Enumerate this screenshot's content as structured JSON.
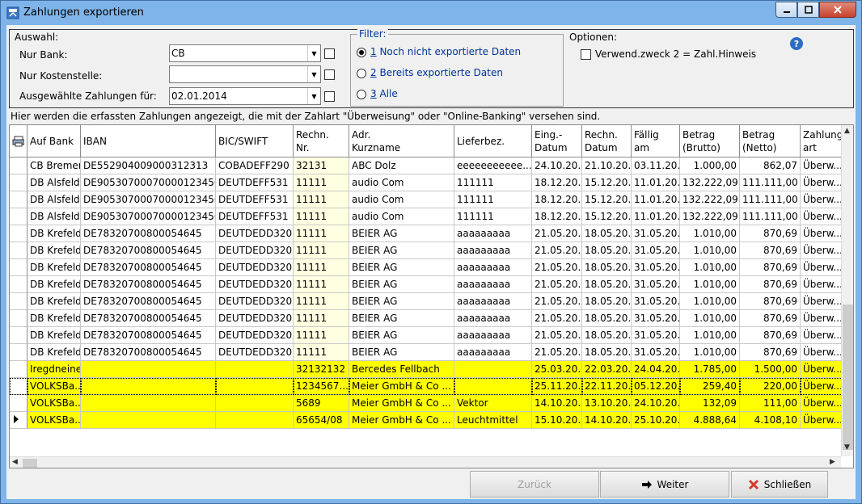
{
  "window": {
    "title": "Zahlungen exportieren"
  },
  "selection": {
    "legend": "Auswahl:",
    "bank_label": "Nur Bank:",
    "bank_value": "CB",
    "cost_label": "Nur Kostenstelle:",
    "cost_value": "",
    "date_label": "Ausgewählte Zahlungen für:",
    "date_value": "02.01.2014"
  },
  "filter": {
    "legend": "Filter:",
    "options": [
      {
        "label": "1 Noch nicht exportierte Daten",
        "selected": true
      },
      {
        "label": "2 Bereits exportierte Daten",
        "selected": false
      },
      {
        "label": "3 Alle",
        "selected": false
      }
    ]
  },
  "options": {
    "legend": "Optionen:",
    "verwendungszweck_label": "Verwend.zweck 2 = Zahl.Hinweis"
  },
  "info_text": "Hier werden die erfassten Zahlungen angezeigt, die mit der Zahlart \"Überweisung\" oder \"Online-Banking\" versehen sind.",
  "grid": {
    "headers": [
      "Auf Bank",
      "IBAN",
      "BIC/SWIFT",
      "Rechn.\nNr.",
      "Adr.\nKurzname",
      "Lieferbez.",
      "Eing.-\nDatum",
      "Rechn.\nDatum",
      "Fällig\nam",
      "Betrag\n(Brutto)",
      "Betrag\n(Netto)",
      "Zahlungs\nart"
    ],
    "rows": [
      {
        "style": "white",
        "cells": [
          "CB Bremen",
          "DE552904009000312313",
          "COBADEFF290",
          "32131",
          "ABC Dolz",
          "eeeeeeeeeee...",
          "24.10.20...",
          "21.10.20...",
          "03.11.20...",
          "1.000,00",
          "862,07",
          "Überw..."
        ]
      },
      {
        "style": "white",
        "cells": [
          "DB Alsfeld",
          "DE90530700070000123456",
          "DEUTDEFF531",
          "11111",
          "audio Com",
          "111111",
          "18.12.20...",
          "15.12.20...",
          "11.01.20...",
          "132.222,09",
          "111.111,00",
          "Überw..."
        ]
      },
      {
        "style": "white",
        "cells": [
          "DB Alsfeld",
          "DE90530700070000123456",
          "DEUTDEFF531",
          "11111",
          "audio Com",
          "111111",
          "18.12.20...",
          "15.12.20...",
          "11.01.20...",
          "132.222,09",
          "111.111,00",
          "Überw..."
        ]
      },
      {
        "style": "white",
        "cells": [
          "DB Alsfeld",
          "DE90530700070000123456",
          "DEUTDEFF531",
          "11111",
          "audio Com",
          "111111",
          "18.12.20...",
          "15.12.20...",
          "11.01.20...",
          "132.222,09",
          "111.111,00",
          "Überw..."
        ]
      },
      {
        "style": "white",
        "cells": [
          "DB Krefeld",
          "DE78320700800054645",
          "DEUTDEDD320",
          "11111",
          "BEIER AG",
          "aaaaaaaaa",
          "21.05.20...",
          "18.05.20...",
          "31.05.20...",
          "1.010,00",
          "870,69",
          "Überw..."
        ]
      },
      {
        "style": "white",
        "cells": [
          "DB Krefeld",
          "DE78320700800054645",
          "DEUTDEDD320",
          "11111",
          "BEIER AG",
          "aaaaaaaaa",
          "21.05.20...",
          "18.05.20...",
          "31.05.20...",
          "1.010,00",
          "870,69",
          "Überw..."
        ]
      },
      {
        "style": "white",
        "cells": [
          "DB Krefeld",
          "DE78320700800054645",
          "DEUTDEDD320",
          "11111",
          "BEIER AG",
          "aaaaaaaaa",
          "21.05.20...",
          "18.05.20...",
          "31.05.20...",
          "1.010,00",
          "870,69",
          "Überw..."
        ]
      },
      {
        "style": "white",
        "cells": [
          "DB Krefeld",
          "DE78320700800054645",
          "DEUTDEDD320",
          "11111",
          "BEIER AG",
          "aaaaaaaaa",
          "21.05.20...",
          "18.05.20...",
          "31.05.20...",
          "1.010,00",
          "870,69",
          "Überw..."
        ]
      },
      {
        "style": "white",
        "cells": [
          "DB Krefeld",
          "DE78320700800054645",
          "DEUTDEDD320",
          "11111",
          "BEIER AG",
          "aaaaaaaaa",
          "21.05.20...",
          "18.05.20...",
          "31.05.20...",
          "1.010,00",
          "870,69",
          "Überw..."
        ]
      },
      {
        "style": "white",
        "cells": [
          "DB Krefeld",
          "DE78320700800054645",
          "DEUTDEDD320",
          "11111",
          "BEIER AG",
          "aaaaaaaaa",
          "21.05.20...",
          "18.05.20...",
          "31.05.20...",
          "1.010,00",
          "870,69",
          "Überw..."
        ]
      },
      {
        "style": "white",
        "cells": [
          "DB Krefeld",
          "DE78320700800054645",
          "DEUTDEDD320",
          "11111",
          "BEIER AG",
          "aaaaaaaaa",
          "21.05.20...",
          "18.05.20...",
          "31.05.20...",
          "1.010,00",
          "870,69",
          "Überw..."
        ]
      },
      {
        "style": "white",
        "cells": [
          "DB Krefeld",
          "DE78320700800054645",
          "DEUTDEDD320",
          "11111",
          "BEIER AG",
          "aaaaaaaaa",
          "21.05.20...",
          "18.05.20...",
          "31.05.20...",
          "1.010,00",
          "870,69",
          "Überw..."
        ]
      },
      {
        "style": "yellow",
        "cells": [
          "Iregdneine",
          "",
          "",
          "32132132",
          "Bercedes Fellbach",
          "",
          "25.03.20...",
          "22.03.20...",
          "24.04.20...",
          "1.785,00",
          "1.500,00",
          "Überw..."
        ]
      },
      {
        "style": "yellow sel",
        "cells": [
          "VOLKSBa...",
          "",
          "",
          "1234567...",
          "Meier GmbH & Co ...",
          "",
          "25.11.20...",
          "22.11.20...",
          "05.12.20...",
          "259,40",
          "220,00",
          "Überw..."
        ]
      },
      {
        "style": "yellow",
        "cells": [
          "VOLKSBa...",
          "",
          "",
          "5689",
          "Meier GmbH & Co ...",
          "Vektor",
          "14.10.20...",
          "13.10.20...",
          "24.10.20...",
          "132,09",
          "111,00",
          "Überw..."
        ]
      },
      {
        "style": "yellow current",
        "cells": [
          "VOLKSBa...",
          "",
          "",
          "65654/08",
          "Meier GmbH & Co ...",
          "Leuchtmittel",
          "15.10.20...",
          "14.10.20...",
          "25.10.20...",
          "4.888,64",
          "4.108,10",
          "Überw..."
        ]
      }
    ]
  },
  "buttons": {
    "back": "Zurück",
    "next": "Weiter",
    "close": "Schließen"
  },
  "colors": {
    "highlight_row": "#ffff00",
    "invoice_column": "#ffffe1",
    "window_frame": "#7eb4ea"
  }
}
